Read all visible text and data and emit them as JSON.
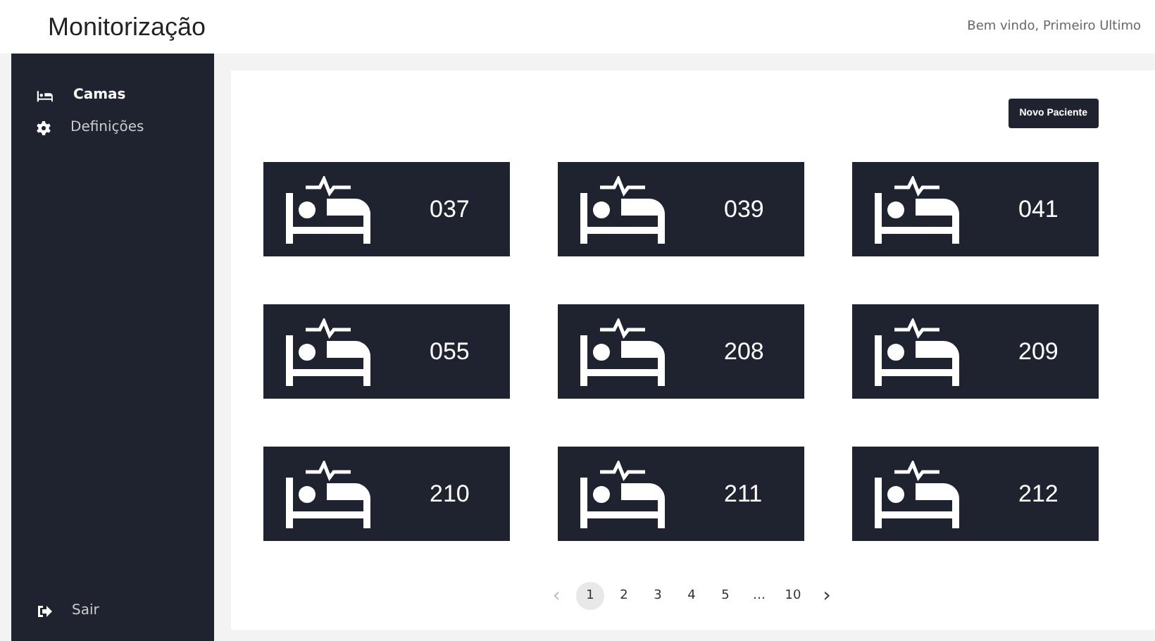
{
  "header": {
    "title": "Monitorização",
    "greeting": "Bem vindo, Primeiro Ultimo"
  },
  "sidebar": {
    "items": [
      {
        "label": "Camas",
        "kind": "bed",
        "selected": true
      },
      {
        "label": "Definições",
        "kind": "gear",
        "selected": false
      }
    ],
    "footer": {
      "label": "Sair",
      "kind": "logout"
    }
  },
  "toolbar": {
    "button": "Novo Paciente"
  },
  "beds": [
    {
      "number": "037"
    },
    {
      "number": "039"
    },
    {
      "number": "041"
    },
    {
      "number": "055"
    },
    {
      "number": "208"
    },
    {
      "number": "209"
    },
    {
      "number": "210"
    },
    {
      "number": "211"
    },
    {
      "number": "212"
    }
  ],
  "pagination": {
    "previous": {
      "label": "‹",
      "disabled": true
    },
    "next": {
      "label": "›",
      "disabled": false
    },
    "pages": [
      {
        "label": "1",
        "selected": true
      },
      {
        "label": "2",
        "selected": false
      },
      {
        "label": "3",
        "selected": false
      },
      {
        "label": "4",
        "selected": false
      },
      {
        "label": "5",
        "selected": false
      },
      {
        "label": "…",
        "selected": false
      },
      {
        "label": "10",
        "selected": false
      }
    ]
  }
}
